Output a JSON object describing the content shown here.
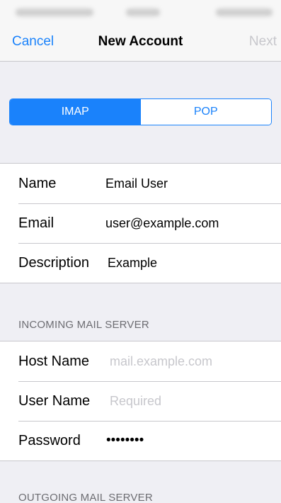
{
  "nav": {
    "cancel_label": "Cancel",
    "title": "New Account",
    "next_label": "Next"
  },
  "account_type": {
    "options": [
      "IMAP",
      "POP"
    ],
    "selected": "IMAP"
  },
  "account_info": {
    "name": {
      "label": "Name",
      "value": "Email User"
    },
    "email": {
      "label": "Email",
      "value": "user@example.com"
    },
    "description": {
      "label": "Description",
      "value": "Example"
    }
  },
  "incoming_server": {
    "header": "INCOMING MAIL SERVER",
    "host_name": {
      "label": "Host Name",
      "placeholder": "mail.example.com"
    },
    "user_name": {
      "label": "User Name",
      "placeholder": "Required"
    },
    "password": {
      "label": "Password",
      "value": "••••••••"
    }
  },
  "outgoing_server": {
    "header": "OUTGOING MAIL SERVER"
  },
  "colors": {
    "accent": "#1a82fb",
    "background": "#efeff4",
    "placeholder": "#c7c7cc",
    "section_header": "#6d6d72"
  }
}
